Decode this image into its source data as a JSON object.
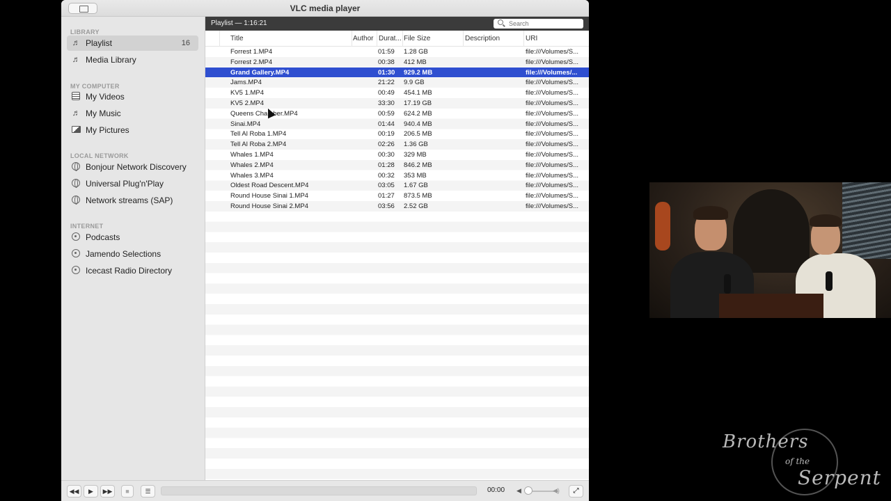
{
  "window": {
    "title": "VLC media player"
  },
  "sidebar": {
    "sections": [
      {
        "heading": "LIBRARY",
        "items": [
          {
            "label": "Playlist",
            "count": "16",
            "icon": "music-note-icon",
            "active": true
          },
          {
            "label": "Media Library",
            "icon": "music-note-icon"
          }
        ]
      },
      {
        "heading": "MY COMPUTER",
        "items": [
          {
            "label": "My Videos",
            "icon": "film-icon"
          },
          {
            "label": "My Music",
            "icon": "music-note-icon"
          },
          {
            "label": "My Pictures",
            "icon": "picture-icon"
          }
        ]
      },
      {
        "heading": "LOCAL NETWORK",
        "items": [
          {
            "label": "Bonjour Network Discovery",
            "icon": "globe-icon"
          },
          {
            "label": "Universal Plug'n'Play",
            "icon": "globe-icon"
          },
          {
            "label": "Network streams (SAP)",
            "icon": "globe-icon"
          }
        ]
      },
      {
        "heading": "INTERNET",
        "items": [
          {
            "label": "Podcasts",
            "icon": "radio-icon"
          },
          {
            "label": "Jamendo Selections",
            "icon": "radio-icon"
          },
          {
            "label": "Icecast Radio Directory",
            "icon": "radio-icon"
          }
        ]
      }
    ]
  },
  "playlist": {
    "header": "Playlist — 1:16:21",
    "search_placeholder": "Search",
    "columns": {
      "title": "Title",
      "author": "Author",
      "duration": "Durat...",
      "size": "File Size",
      "description": "Description",
      "uri": "URI"
    },
    "selected_index": 2,
    "rows": [
      {
        "title": "Forrest 1.MP4",
        "duration": "01:59",
        "size": "1.28 GB",
        "uri": "file:///Volumes/S..."
      },
      {
        "title": "Forrest 2.MP4",
        "duration": "00:38",
        "size": "412 MB",
        "uri": "file:///Volumes/S..."
      },
      {
        "title": "Grand Gallery.MP4",
        "duration": "01:30",
        "size": "929.2 MB",
        "uri": "file:///Volumes/..."
      },
      {
        "title": "Jams.MP4",
        "duration": "21:22",
        "size": "9.9 GB",
        "uri": "file:///Volumes/S..."
      },
      {
        "title": "KV5 1.MP4",
        "duration": "00:49",
        "size": "454.1 MB",
        "uri": "file:///Volumes/S..."
      },
      {
        "title": "KV5 2.MP4",
        "duration": "33:30",
        "size": "17.19 GB",
        "uri": "file:///Volumes/S..."
      },
      {
        "title": "Queens Chamber.MP4",
        "duration": "00:59",
        "size": "624.2 MB",
        "uri": "file:///Volumes/S..."
      },
      {
        "title": "Sinai.MP4",
        "duration": "01:44",
        "size": "940.4 MB",
        "uri": "file:///Volumes/S..."
      },
      {
        "title": "Tell Al Roba 1.MP4",
        "duration": "00:19",
        "size": "206.5 MB",
        "uri": "file:///Volumes/S..."
      },
      {
        "title": "Tell Al Roba 2.MP4",
        "duration": "02:26",
        "size": "1.36 GB",
        "uri": "file:///Volumes/S..."
      },
      {
        "title": "Whales 1.MP4",
        "duration": "00:30",
        "size": "329 MB",
        "uri": "file:///Volumes/S..."
      },
      {
        "title": "Whales 2.MP4",
        "duration": "01:28",
        "size": "846.2 MB",
        "uri": "file:///Volumes/S..."
      },
      {
        "title": "Whales 3.MP4",
        "duration": "00:32",
        "size": "353 MB",
        "uri": "file:///Volumes/S..."
      },
      {
        "title": "Oldest Road Descent.MP4",
        "duration": "03:05",
        "size": "1.67 GB",
        "uri": "file:///Volumes/S..."
      },
      {
        "title": "Round House Sinai 1.MP4",
        "duration": "01:27",
        "size": "873.5 MB",
        "uri": "file:///Volumes/S..."
      },
      {
        "title": "Round House Sinai 2.MP4",
        "duration": "03:56",
        "size": "2.52 GB",
        "uri": "file:///Volumes/S..."
      }
    ]
  },
  "controls": {
    "time": "00:00",
    "progress": 0,
    "volume": 0
  },
  "overlay": {
    "logo_line1": "Brothers",
    "logo_line2": "of the",
    "logo_line3": "Serpent"
  },
  "colors": {
    "selection": "#2f4fd0",
    "header_bar": "#3b3b3b"
  }
}
